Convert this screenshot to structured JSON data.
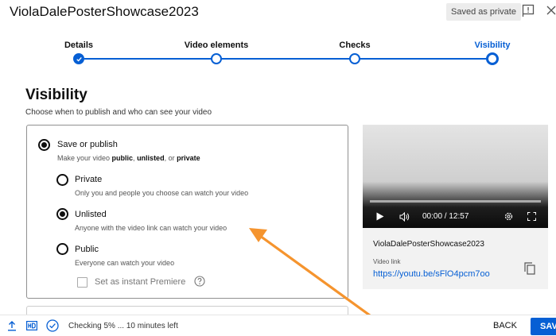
{
  "header": {
    "title": "ViolaDalePosterShowcase2023",
    "saved_badge": "Saved as private"
  },
  "stepper": {
    "steps": [
      {
        "label": "Details",
        "state": "done"
      },
      {
        "label": "Video elements",
        "state": "done"
      },
      {
        "label": "Checks",
        "state": "done"
      },
      {
        "label": "Visibility",
        "state": "current"
      }
    ]
  },
  "visibility": {
    "title": "Visibility",
    "subtitle": "Choose when to publish and who can see your video",
    "save_or_publish": {
      "label": "Save or publish",
      "desc_prefix": "Make your video ",
      "desc_public": "public",
      "desc_sep1": ", ",
      "desc_unlisted": "unlisted",
      "desc_sep2": ", or ",
      "desc_private": "private",
      "selected": true
    },
    "options": [
      {
        "label": "Private",
        "desc": "Only you and people you choose can watch your video",
        "selected": false
      },
      {
        "label": "Unlisted",
        "desc": "Anyone with the video link can watch your video",
        "selected": true
      },
      {
        "label": "Public",
        "desc": "Everyone can watch your video",
        "selected": false
      }
    ],
    "premiere_label": "Set as instant Premiere",
    "premiere_checked": false
  },
  "preview": {
    "time": "00:00 / 12:57",
    "playback_progress": 0,
    "title": "ViolaDalePosterShowcase2023",
    "link_label": "Video link",
    "link_url": "https://youtu.be/sFlO4pcm7oo"
  },
  "footer": {
    "status": "Checking 5% ... 10 minutes left",
    "back_label": "BACK",
    "save_label": "SAVE"
  },
  "colors": {
    "accent": "#065fd4",
    "annotation_arrow": "#f5942e"
  }
}
